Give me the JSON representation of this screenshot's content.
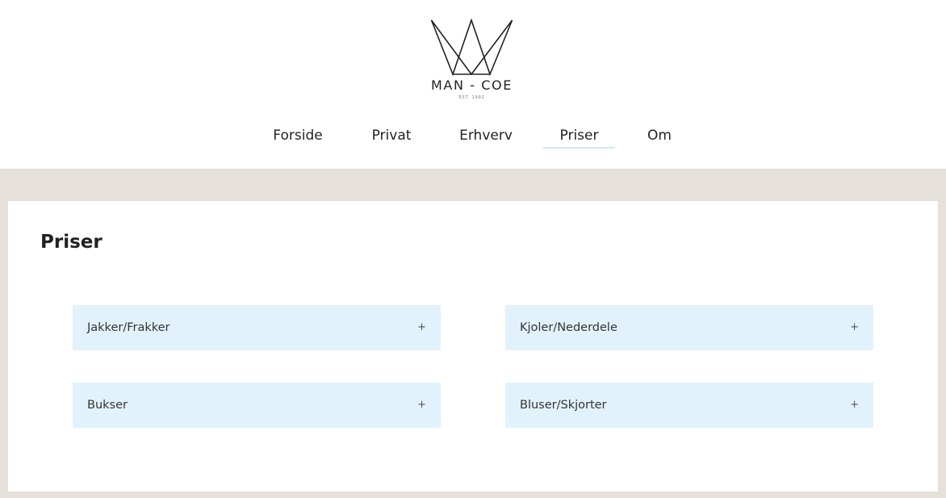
{
  "logo": {
    "name": "MAN - COE",
    "tagline": "EST. 1992",
    "icon": "crown-icon"
  },
  "nav": {
    "items": [
      {
        "label": "Forside"
      },
      {
        "label": "Privat"
      },
      {
        "label": "Erhverv"
      },
      {
        "label": "Priser",
        "active": true
      },
      {
        "label": "Om"
      }
    ],
    "active_underline_color": "#cfe6f6"
  },
  "page": {
    "title": "Priser"
  },
  "accordions": [
    {
      "label": "Jakker/Frakker",
      "icon": "plus-icon",
      "symbol": "+"
    },
    {
      "label": "Kjoler/Nederdele",
      "icon": "plus-icon",
      "symbol": "+"
    },
    {
      "label": "Bukser",
      "icon": "plus-icon",
      "symbol": "+"
    },
    {
      "label": "Bluser/Skjorter",
      "icon": "plus-icon",
      "symbol": "+"
    }
  ],
  "colors": {
    "background_band": "#e5e0da",
    "accordion_bg": "#e2f2fc",
    "text": "#222222"
  }
}
